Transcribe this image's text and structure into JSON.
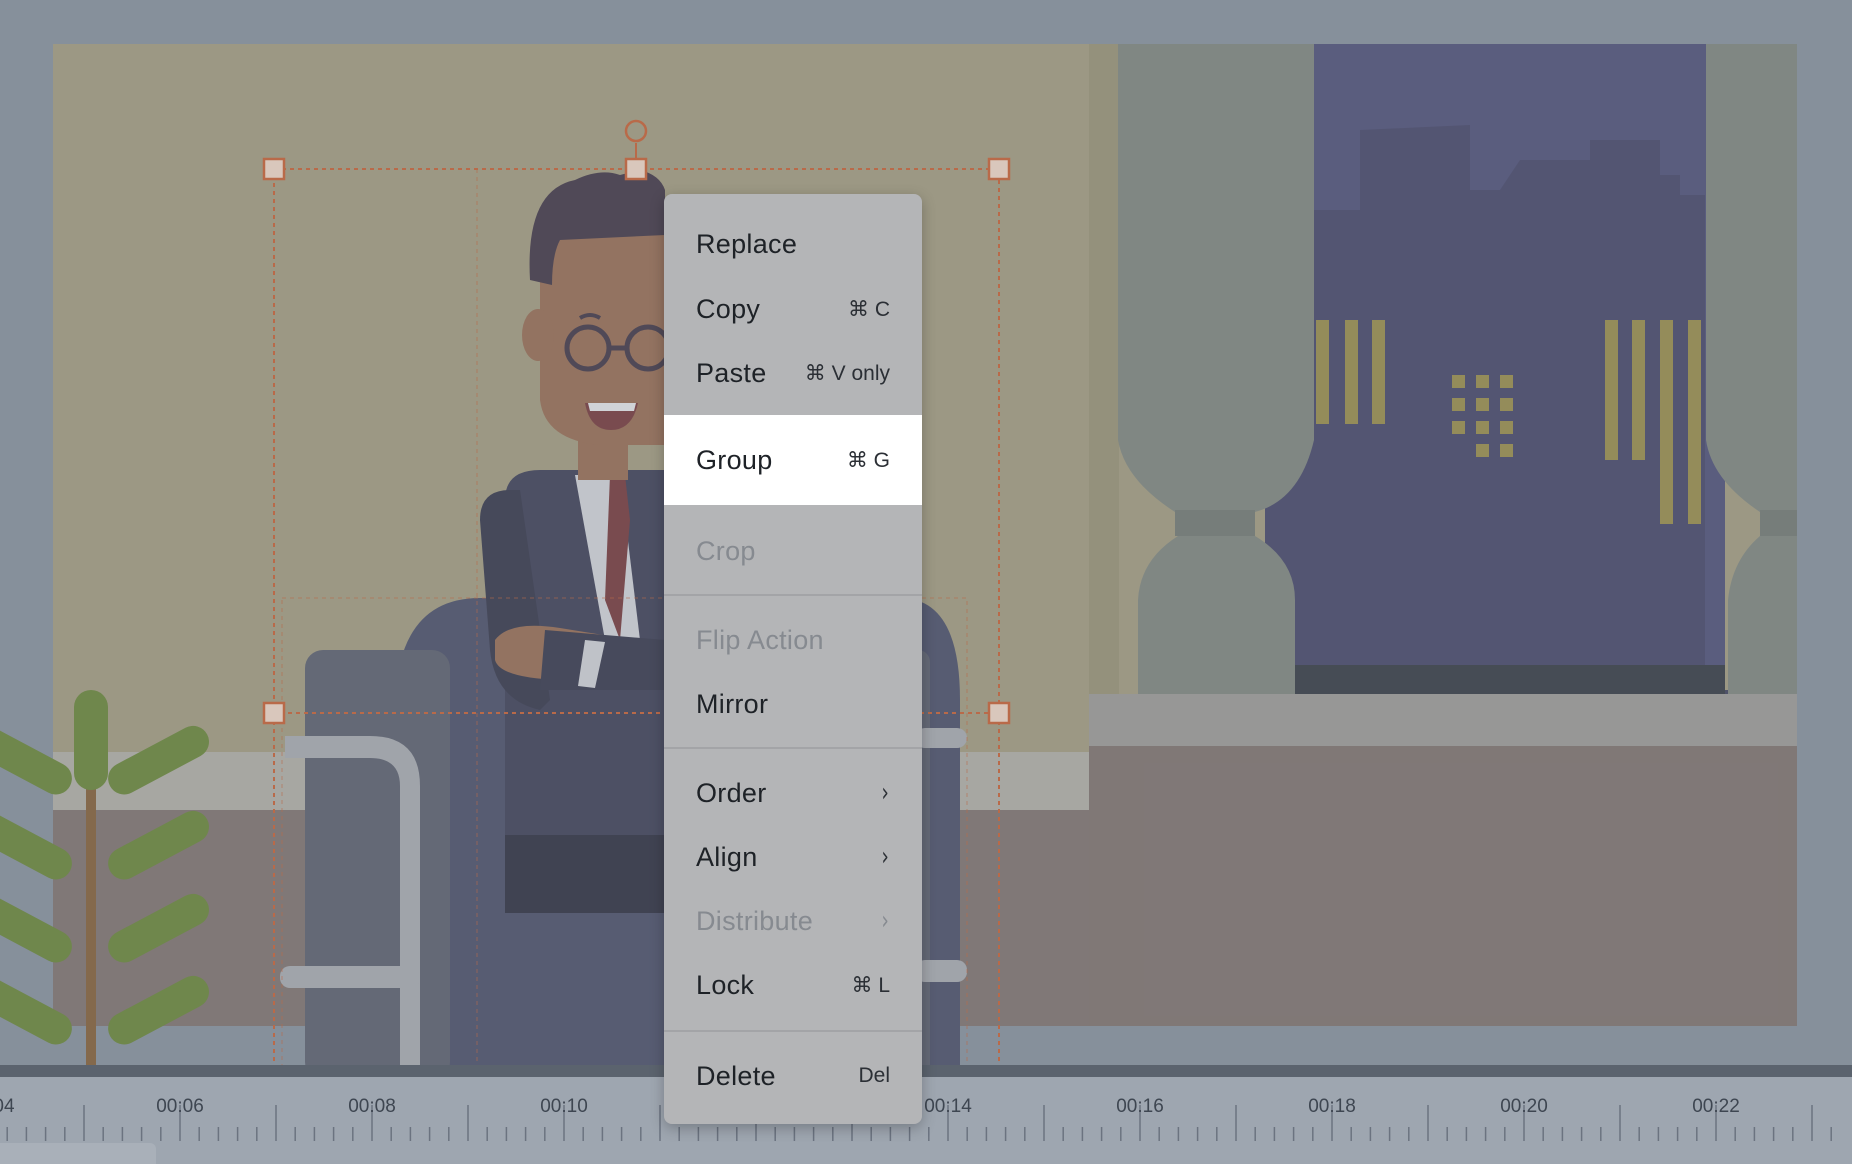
{
  "context_menu": {
    "items": [
      {
        "label": "Replace",
        "shortcut": "",
        "enabled": true
      },
      {
        "label": "Copy",
        "shortcut": "⌘ C",
        "enabled": true
      },
      {
        "label": "Paste",
        "shortcut": "⌘ V only",
        "enabled": true
      },
      {
        "label": "Group",
        "shortcut": "⌘ G",
        "enabled": true,
        "highlighted": true
      },
      {
        "label": "Crop",
        "shortcut": "",
        "enabled": false
      },
      {
        "label": "Flip Action",
        "shortcut": "",
        "enabled": false
      },
      {
        "label": "Mirror",
        "shortcut": "",
        "enabled": true
      },
      {
        "label": "Order",
        "shortcut": "",
        "enabled": true,
        "submenu": true
      },
      {
        "label": "Align",
        "shortcut": "",
        "enabled": true,
        "submenu": true
      },
      {
        "label": "Distribute",
        "shortcut": "",
        "enabled": false,
        "submenu": true
      },
      {
        "label": "Lock",
        "shortcut": "⌘ L",
        "enabled": true
      },
      {
        "label": "Delete",
        "shortcut": "Del",
        "enabled": true
      }
    ],
    "submenu_glyph": "›"
  },
  "timeline": {
    "ticks": [
      "04",
      "00:06",
      "00:08",
      "00:10",
      "00:14",
      "00:16",
      "00:18",
      "00:20",
      "00:22"
    ]
  },
  "colors": {
    "overlay": "#8e98a4",
    "wall": "#b3a882",
    "floor": "#84736b",
    "night_sky": "#4b4a77",
    "buildings": "#3e3e63",
    "curtain": "#858b7e",
    "selection": "#b96a49",
    "menu_bg": "#b4b5b7",
    "menu_highlight": "#ffffff"
  },
  "icons": [
    "rotate-handle-icon",
    "resize-handle-icon",
    "submenu-chevron-icon"
  ]
}
